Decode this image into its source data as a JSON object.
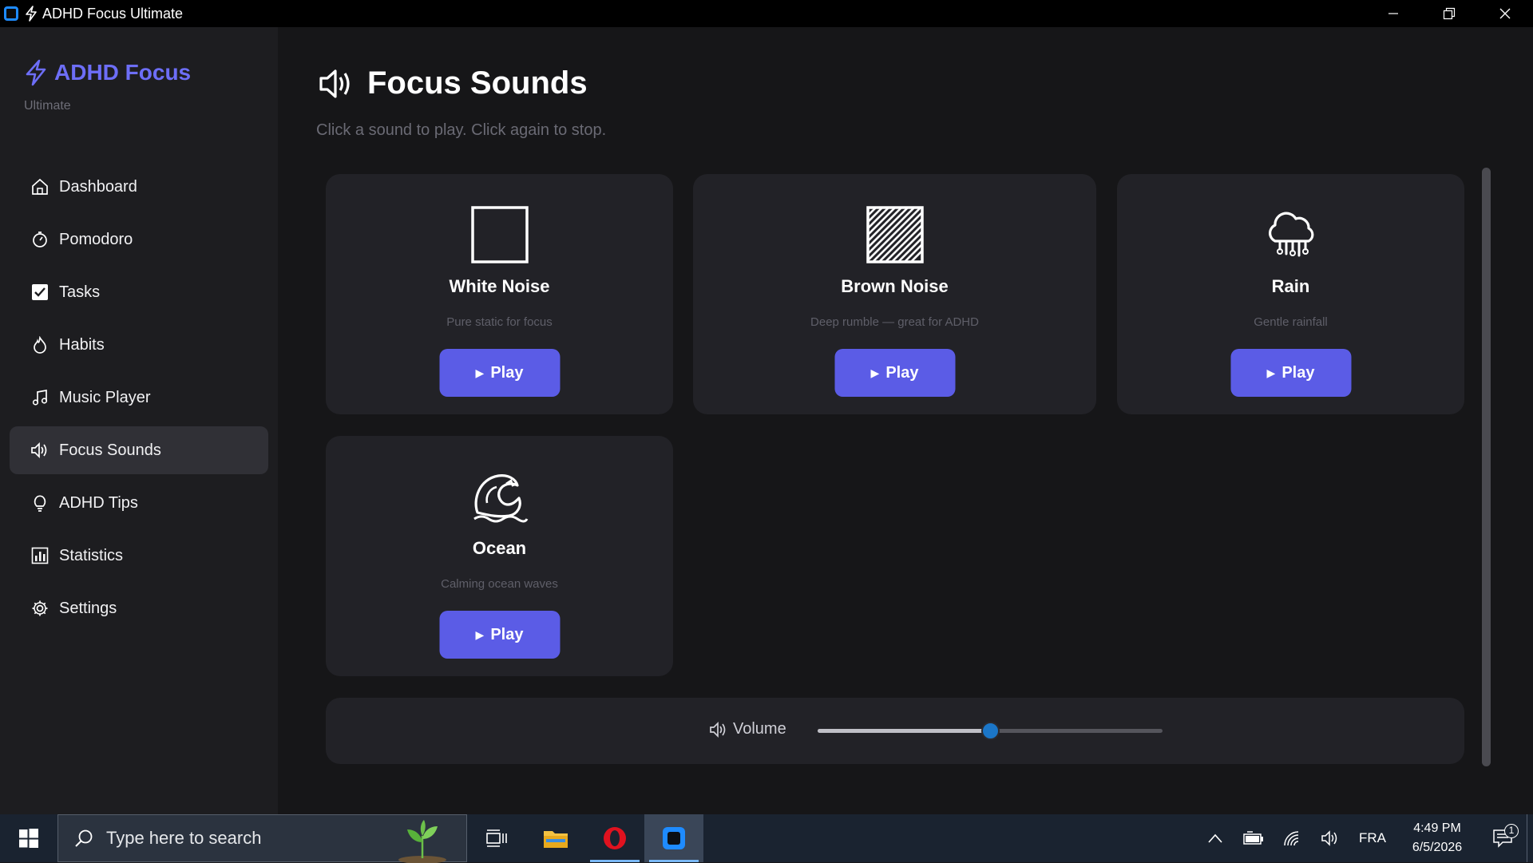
{
  "window": {
    "title": "ADHD Focus Ultimate"
  },
  "brand": {
    "name": "ADHD Focus",
    "subtitle": "Ultimate",
    "accent": "#6d6ef7"
  },
  "nav": {
    "items": [
      {
        "label": "Dashboard",
        "icon": "home-icon"
      },
      {
        "label": "Pomodoro",
        "icon": "stopwatch-icon"
      },
      {
        "label": "Tasks",
        "icon": "checkbox-icon"
      },
      {
        "label": "Habits",
        "icon": "flame-icon"
      },
      {
        "label": "Music Player",
        "icon": "music-note-icon"
      },
      {
        "label": "Focus Sounds",
        "icon": "speaker-icon",
        "active": true
      },
      {
        "label": "ADHD Tips",
        "icon": "lightbulb-icon"
      },
      {
        "label": "Statistics",
        "icon": "bar-chart-icon"
      },
      {
        "label": "Settings",
        "icon": "gear-icon"
      }
    ]
  },
  "page": {
    "title": "Focus Sounds",
    "subtitle": "Click a sound to play. Click again to stop."
  },
  "sounds": [
    {
      "name": "White Noise",
      "desc": "Pure static for focus",
      "button": "Play",
      "icon": "empty-square-icon"
    },
    {
      "name": "Brown Noise",
      "desc": "Deep rumble — great for ADHD",
      "button": "Play",
      "icon": "hatched-square-icon"
    },
    {
      "name": "Rain",
      "desc": "Gentle rainfall",
      "button": "Play",
      "icon": "rain-cloud-icon"
    },
    {
      "name": "Ocean",
      "desc": "Calming ocean waves",
      "button": "Play",
      "icon": "wave-icon"
    }
  ],
  "volume": {
    "label": "Volume",
    "value": 0.5
  },
  "taskbar": {
    "search_placeholder": "Type here to search",
    "language": "FRA",
    "time": "4:49 PM",
    "date": "6/5/2026",
    "notification_count": "1"
  },
  "colors": {
    "button": "#5b5ce6",
    "slider_thumb": "#1b76c8"
  }
}
